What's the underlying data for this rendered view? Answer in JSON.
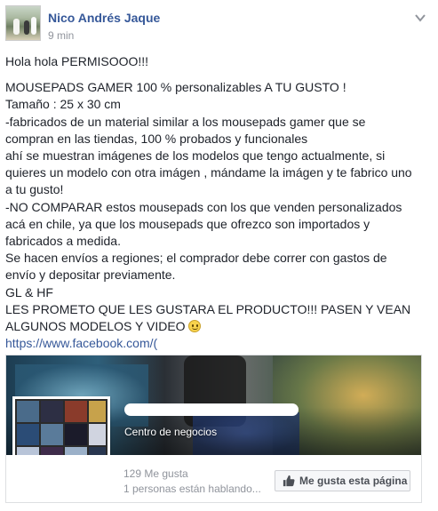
{
  "post": {
    "author": "Nico Andrés Jaque",
    "timestamp": "9 min",
    "lines": [
      "Hola hola PERMISOOO!!!",
      "MOUSEPADS GAMER 100 % personalizables A TU GUSTO !",
      "Tamaño : 25 x 30 cm",
      "-fabricados de un material similar a los mousepads gamer que se",
      "compran en las tiendas, 100 % probados y funcionales",
      "ahí se muestran imágenes de los modelos que tengo actualmente, si",
      "quieres un modelo con otra imágen , mándame la imágen y te fabrico uno",
      "a tu gusto!",
      "-NO COMPARAR estos mousepads con los que venden personalizados",
      "acá en chile, ya que los mousepads que ofrezco son importados y",
      "fabricados a medida.",
      "Se hacen envíos a regiones; el comprador debe correr con gastos de",
      "envío y depositar previamente.",
      "GL & HF",
      "LES PROMETO QUE LES GUSTARA EL PRODUCTO!!! PASEN Y VEAN",
      "ALGUNOS MODELOS Y VIDEO"
    ],
    "link": "https://www.facebook.com/("
  },
  "card": {
    "category": "Centro de negocios",
    "likes": "129 Me gusta",
    "talking": "1 personas están hablando...",
    "like_button": "Me gusta esta página"
  },
  "icons": {
    "options": "chevron-down-icon",
    "privacy": "globe-icon",
    "emoji": "smiley-icon",
    "like": "thumbs-up-icon"
  },
  "colors": {
    "link": "#365899",
    "meta": "#90949c",
    "text": "#1d2129"
  }
}
